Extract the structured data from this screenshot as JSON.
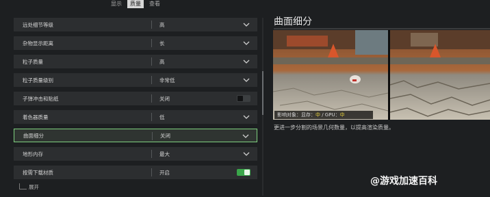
{
  "tabs": [
    "显示",
    "质量",
    "查看"
  ],
  "settings": [
    {
      "label": "远处细节等级",
      "value": "高",
      "control": "dropdown"
    },
    {
      "label": "杂物显示距离",
      "value": "长",
      "control": "dropdown"
    },
    {
      "label": "粒子质量",
      "value": "高",
      "control": "dropdown"
    },
    {
      "label": "粒子质量级别",
      "value": "非常低",
      "control": "dropdown"
    },
    {
      "label": "子弹冲击和贴纸",
      "value": "关闭",
      "control": "toggle",
      "on": false
    },
    {
      "label": "着色器质量",
      "value": "低",
      "control": "dropdown"
    },
    {
      "label": "曲面细分",
      "value": "关闭",
      "control": "dropdown",
      "selected": true
    },
    {
      "label": "地形内存",
      "value": "最大",
      "control": "dropdown"
    },
    {
      "label": "按需下载材质",
      "value": "开启",
      "control": "toggle",
      "on": true
    }
  ],
  "expand_label": "展开",
  "preview": {
    "title": "曲面细分",
    "impact_prefix": "影响对象：显存：",
    "impact_vram": "中",
    "impact_mid": " / GPU：",
    "impact_gpu": "中",
    "description": "更进一步分割的场景几何数量，以提高渲染质量。"
  },
  "watermark": "@游戏加速百科",
  "colors": {
    "accent_green": "#7fd27f",
    "toggle_on": "#3aa64a",
    "impact_highlight": "#e8d23c"
  }
}
